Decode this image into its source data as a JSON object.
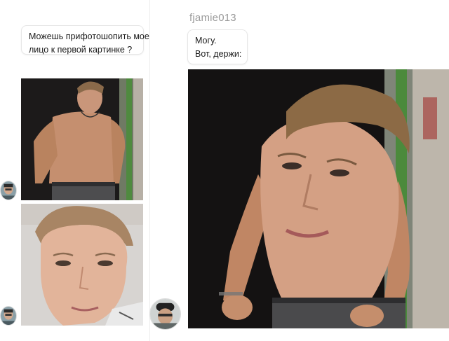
{
  "conversation": {
    "left_message": {
      "lines": [
        "Можешь прифотошопить мое",
        "лицо к первой картинке ?"
      ]
    },
    "right_header": {
      "username": "fjamie013"
    },
    "right_message": {
      "lines": [
        "Могу.",
        "Вот, держи:"
      ]
    }
  },
  "photos": {
    "reference": "photo-shirtless-model",
    "face": "photo-face-selfie",
    "result": "photo-edited-composite"
  },
  "avatars": {
    "sender": "user-avatar",
    "responder": "responder-avatar"
  },
  "colors": {
    "username": "#9a9a9a",
    "bubble_border": "#e6e6e6",
    "background": "#ffffff"
  }
}
